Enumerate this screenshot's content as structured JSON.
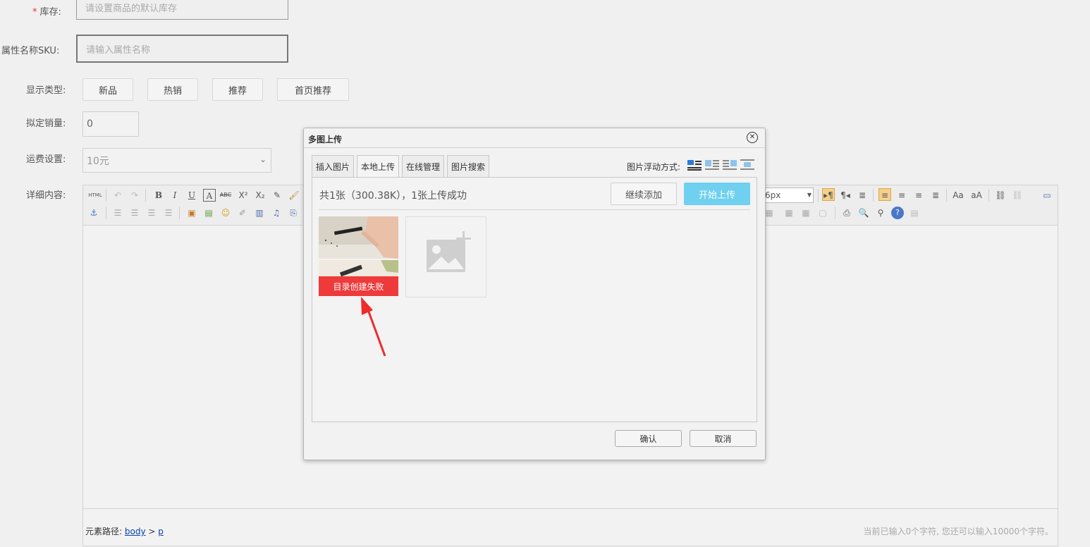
{
  "form": {
    "stock": {
      "required_mark": "*",
      "label": "库存:",
      "placeholder": "请设置商品的默认库存"
    },
    "sku": {
      "label": "属性名称SKU:",
      "placeholder": "请输入属性名称"
    },
    "display_type": {
      "label": "显示类型:",
      "options": [
        "新品",
        "热销",
        "推荐",
        "首页推荐"
      ]
    },
    "sales": {
      "label": "拟定销量:",
      "value": "0"
    },
    "shipping": {
      "label": "运费设置:",
      "value": "10元"
    },
    "detail": {
      "label": "详细内容:"
    }
  },
  "editor": {
    "html_btn": "HTML",
    "font_size_value": "6px",
    "path_label": "元素路径:",
    "path_body": "body",
    "path_sep": ">",
    "path_p": "p",
    "char_count": "当前已输入0个字符, 您还可以输入10000个字符。"
  },
  "dialog": {
    "title": "多图上传",
    "close": "✕",
    "tabs": [
      "插入图片",
      "本地上传",
      "在线管理",
      "图片搜索"
    ],
    "active_tab": 1,
    "float_label": "图片浮动方式:",
    "summary": "共1张（300.38K），1张上传成功",
    "continue_add": "继续添加",
    "start_upload": "开始上传",
    "thumb_error": "目录创建失败",
    "ok": "确认",
    "cancel": "取消"
  },
  "colors": {
    "error_red": "#ee3a3a",
    "upload_blue": "#6fd0ef",
    "required_red": "#e33"
  }
}
